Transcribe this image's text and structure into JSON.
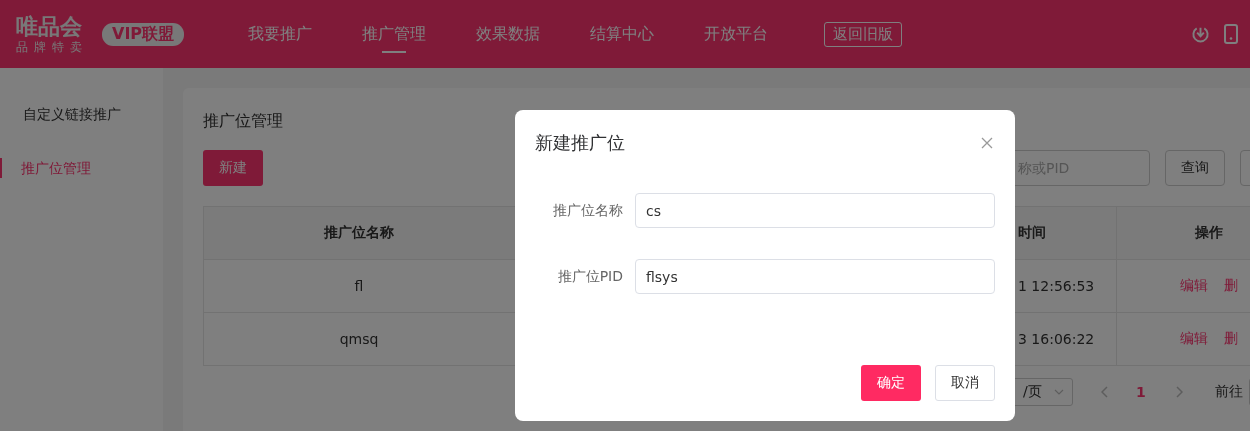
{
  "header": {
    "logo_title": "唯品会",
    "logo_subtitle": "品牌特卖",
    "badge": "VIP联盟",
    "nav": [
      {
        "label": "我要推广",
        "selected": false
      },
      {
        "label": "推广管理",
        "selected": true
      },
      {
        "label": "效果数据",
        "selected": false
      },
      {
        "label": "结算中心",
        "selected": false
      },
      {
        "label": "开放平台",
        "selected": false
      }
    ],
    "old_version_button": "返回旧版"
  },
  "sidebar": {
    "items": [
      {
        "label": "自定义链接推广",
        "selected": false
      },
      {
        "label": "推广位管理",
        "selected": true
      }
    ]
  },
  "page": {
    "title": "推广位管理",
    "new_button": "新建",
    "search": {
      "placeholder": "称或PID"
    },
    "query_button": "查询",
    "table": {
      "columns": [
        {
          "label": "推广位名称"
        },
        {
          "label": "时间"
        },
        {
          "label": "操作"
        }
      ],
      "rows": [
        {
          "name": "fl",
          "time": "1 12:56:53",
          "actions": [
            "编辑",
            "删"
          ]
        },
        {
          "name": "qmsq",
          "time": "3 16:06:22",
          "actions": [
            "编辑",
            "删"
          ]
        }
      ]
    },
    "pagination": {
      "page_size": "/页",
      "page": "1",
      "goto_label": "前往"
    }
  },
  "dialog": {
    "title": "新建推广位",
    "fields": [
      {
        "label": "推广位名称",
        "value": "cs"
      },
      {
        "label": "推广位PID",
        "value": "flsys"
      }
    ],
    "confirm_button": "确定",
    "cancel_button": "取消"
  }
}
